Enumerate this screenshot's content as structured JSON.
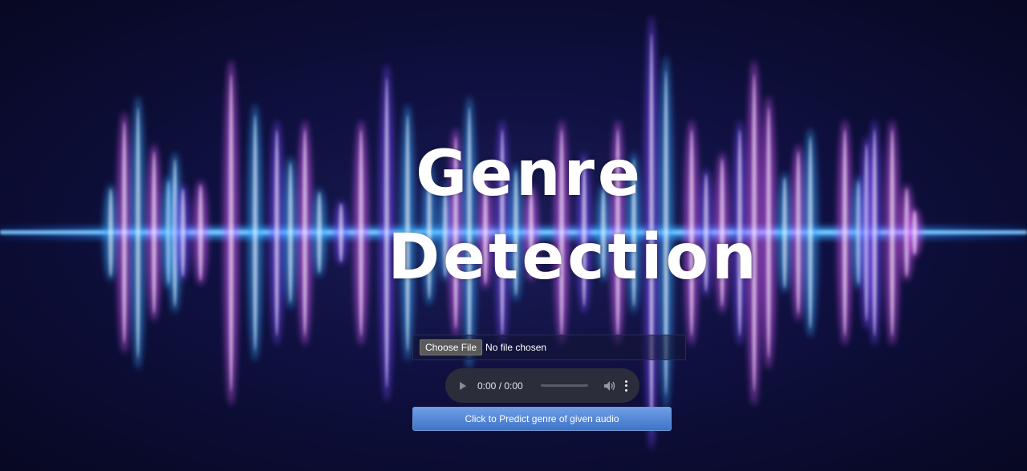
{
  "page": {
    "title_line1": "Genre",
    "title_line2": "Detection"
  },
  "file_input": {
    "button_label": "Choose File",
    "status": "No file chosen"
  },
  "audio_player": {
    "time_display": "0:00 / 0:00",
    "progress": 0,
    "icons": [
      "play-icon",
      "volume-icon",
      "more-options-icon"
    ]
  },
  "predict_button": {
    "label": "Click to Predict genre of given audio"
  },
  "colors": {
    "background": "#0f1040",
    "wave_blue": "#3aa8ff",
    "wave_pink": "#e060ff",
    "wave_purple": "#7a4cff",
    "button_blue": "#4f84d6"
  }
}
